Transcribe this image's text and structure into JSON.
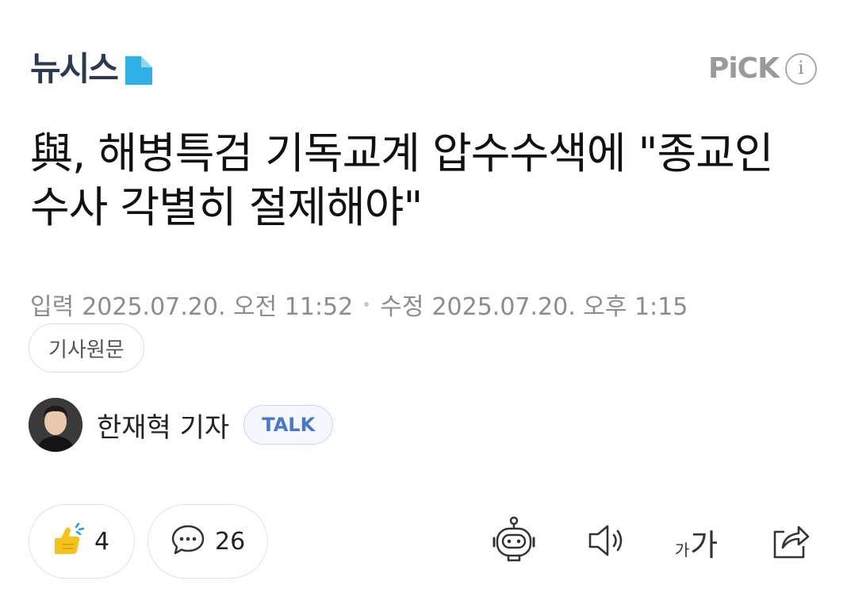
{
  "header": {
    "logo_text": "뉴시스",
    "pick_label": "PiCK",
    "info_glyph": "i"
  },
  "article": {
    "headline": "與, 해병특검 기독교계 압수수색에 \"종교인 수사 각별히 절제해야\"",
    "input_label": "입력",
    "input_time": "2025.07.20. 오전 11:52",
    "modified_label": "수정",
    "modified_time": "2025.07.20. 오후 1:15",
    "origin_label": "기사원문"
  },
  "author": {
    "name": "한재혁 기자",
    "talk_label": "TALK"
  },
  "reactions": {
    "like_count": "4",
    "comment_count": "26"
  },
  "tools": {
    "font_small": "가",
    "font_big": "가"
  },
  "icons": {
    "logo": "newsis-logo-mark",
    "info": "info-icon",
    "like": "thumbs-up-icon",
    "comment": "speech-bubble-icon",
    "summary": "robot-icon",
    "audio": "speaker-icon",
    "font": "font-size-icon",
    "share": "share-icon"
  },
  "colors": {
    "logo_text": "#2b3a4f",
    "logo_accent": "#2fb0e6",
    "talk_text": "#4a78c8",
    "like_yellow": "#f5c21b",
    "like_accent": "#1e9be8"
  }
}
